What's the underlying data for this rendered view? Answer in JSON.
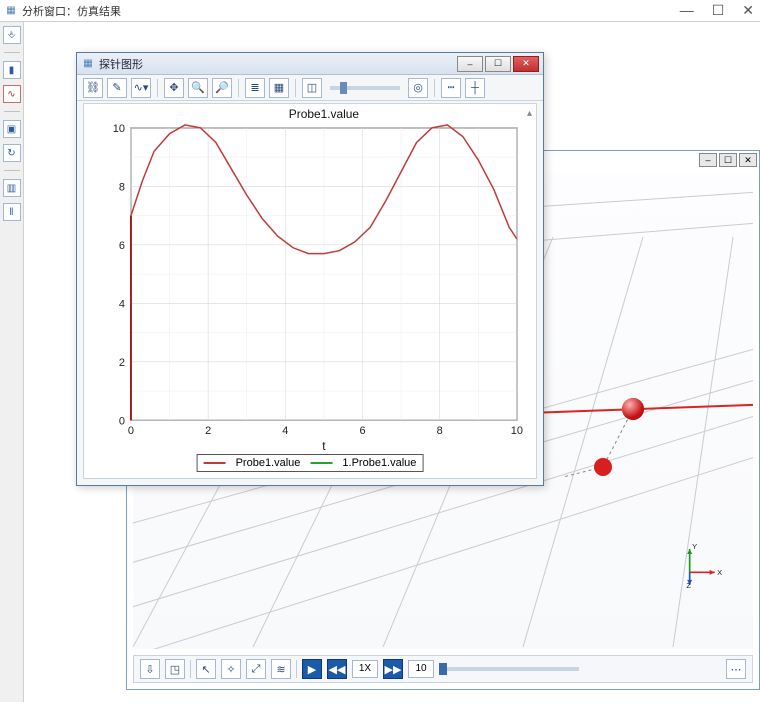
{
  "main_window": {
    "title": "分析窗口：仿真结果",
    "sys": {
      "min": "—",
      "max": "☐",
      "close": "✕"
    }
  },
  "viewport": {
    "sys": {
      "min": "–",
      "max": "☐",
      "close": "✕"
    },
    "toolbar": {
      "scale_label": "1X",
      "frame_label": "10"
    },
    "axes": {
      "x": "X",
      "y": "Y",
      "z": "Z"
    }
  },
  "probe": {
    "title": "探针图形",
    "sys": {
      "min": "–",
      "max": "☐",
      "close": "✕"
    }
  },
  "chart_data": {
    "type": "line",
    "title": "Probe1.value",
    "xlabel": "t",
    "ylabel": "",
    "xlim": [
      0,
      10
    ],
    "ylim": [
      0,
      10
    ],
    "xticks": [
      0,
      2,
      4,
      6,
      8,
      10
    ],
    "yticks": [
      0,
      2,
      4,
      6,
      8,
      10
    ],
    "series": [
      {
        "name": "Probe1.value",
        "color": "#c23a3a",
        "x": [
          0,
          0.3,
          0.6,
          1.0,
          1.4,
          1.8,
          2.2,
          2.6,
          3.0,
          3.4,
          3.8,
          4.2,
          4.6,
          5.0,
          5.4,
          5.8,
          6.2,
          6.6,
          7.0,
          7.4,
          7.8,
          8.2,
          8.6,
          9.0,
          9.4,
          9.8,
          10.0
        ],
        "y": [
          7.0,
          8.2,
          9.2,
          9.8,
          10.1,
          10.0,
          9.5,
          8.6,
          7.7,
          6.9,
          6.3,
          5.9,
          5.7,
          5.7,
          5.8,
          6.1,
          6.6,
          7.5,
          8.5,
          9.5,
          10.0,
          10.1,
          9.7,
          8.9,
          7.9,
          6.6,
          6.2
        ]
      },
      {
        "name": "1.Probe1.value",
        "color": "#2aa02a",
        "x": [],
        "y": []
      }
    ]
  }
}
